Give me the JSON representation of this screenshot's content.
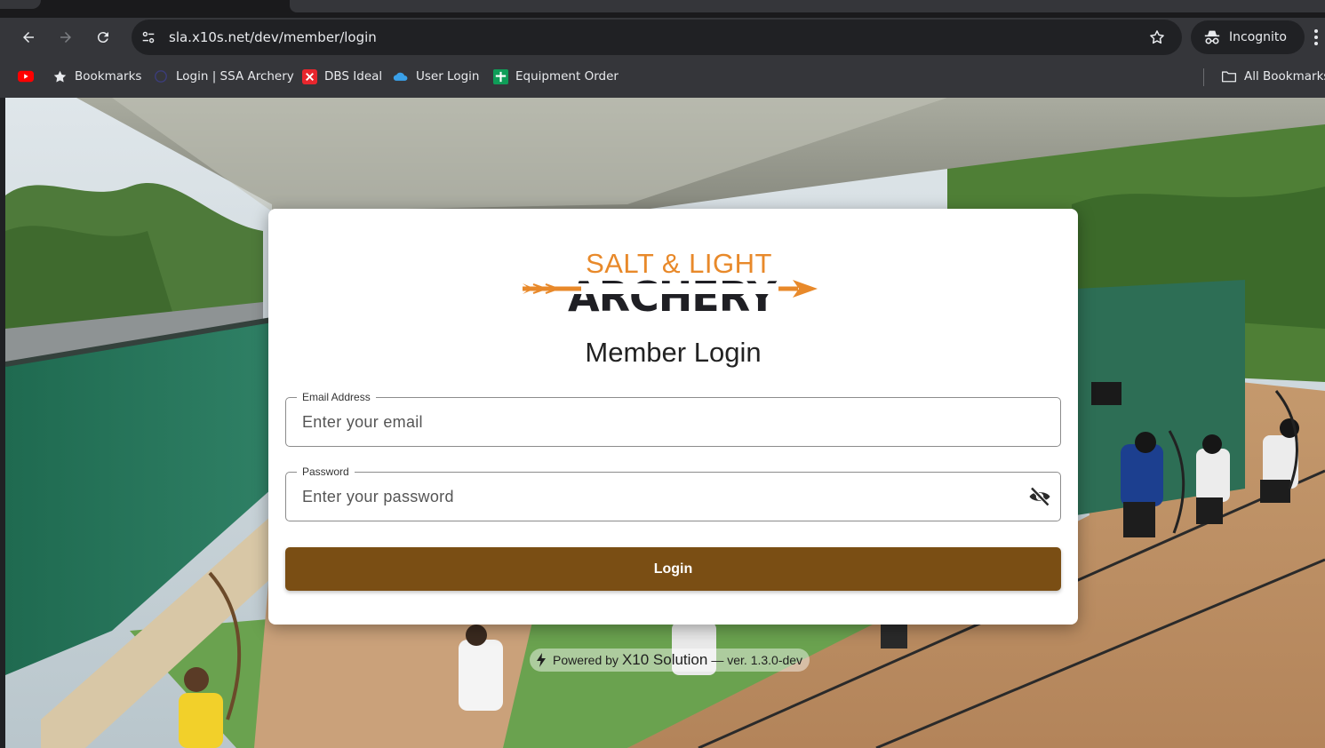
{
  "browser": {
    "url": "sla.x10s.net/dev/member/login",
    "incognito_label": "Incognito",
    "bookmarks": [
      {
        "label": "Bookmarks",
        "icon": "star-icon"
      },
      {
        "label": "Login | SSA Archery",
        "icon": "globe-icon"
      },
      {
        "label": "DBS Ideal",
        "icon": "dbs-icon"
      },
      {
        "label": "User Login",
        "icon": "cloud-icon"
      },
      {
        "label": "Equipment Order",
        "icon": "sheets-icon"
      }
    ],
    "all_bookmarks_label": "All Bookmarks"
  },
  "login": {
    "logo_line1": "SALT & LIGHT",
    "logo_line2": "ARCHERY",
    "title": "Member Login",
    "email_label": "Email Address",
    "email_placeholder": "Enter your email",
    "password_label": "Password",
    "password_placeholder": "Enter your password",
    "button_label": "Login"
  },
  "footer": {
    "prefix": "Powered by",
    "brand": "X10 Solution",
    "version": "— ver. 1.3.0-dev"
  },
  "colors": {
    "button": "#7a4e14",
    "logo_orange": "#e8892a",
    "logo_dark": "#1f1f24"
  }
}
